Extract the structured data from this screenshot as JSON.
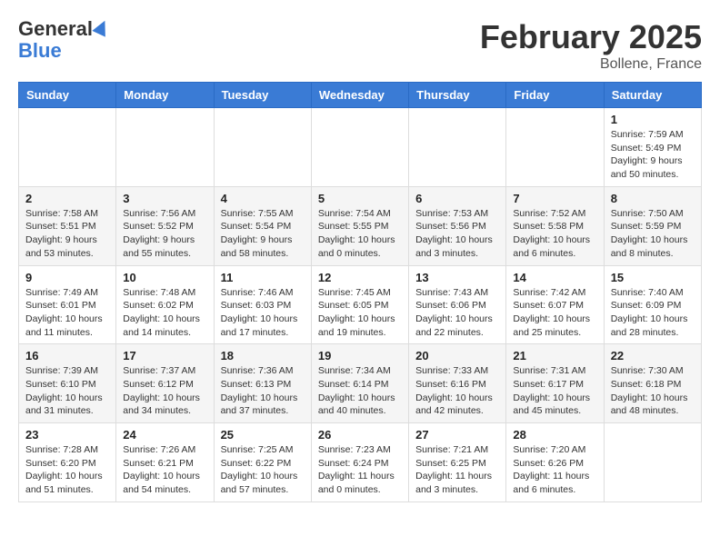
{
  "logo": {
    "general": "General",
    "blue": "Blue"
  },
  "header": {
    "month": "February 2025",
    "location": "Bollene, France"
  },
  "weekdays": [
    "Sunday",
    "Monday",
    "Tuesday",
    "Wednesday",
    "Thursday",
    "Friday",
    "Saturday"
  ],
  "weeks": [
    [
      {
        "day": "",
        "info": ""
      },
      {
        "day": "",
        "info": ""
      },
      {
        "day": "",
        "info": ""
      },
      {
        "day": "",
        "info": ""
      },
      {
        "day": "",
        "info": ""
      },
      {
        "day": "",
        "info": ""
      },
      {
        "day": "1",
        "info": "Sunrise: 7:59 AM\nSunset: 5:49 PM\nDaylight: 9 hours and 50 minutes."
      }
    ],
    [
      {
        "day": "2",
        "info": "Sunrise: 7:58 AM\nSunset: 5:51 PM\nDaylight: 9 hours and 53 minutes."
      },
      {
        "day": "3",
        "info": "Sunrise: 7:56 AM\nSunset: 5:52 PM\nDaylight: 9 hours and 55 minutes."
      },
      {
        "day": "4",
        "info": "Sunrise: 7:55 AM\nSunset: 5:54 PM\nDaylight: 9 hours and 58 minutes."
      },
      {
        "day": "5",
        "info": "Sunrise: 7:54 AM\nSunset: 5:55 PM\nDaylight: 10 hours and 0 minutes."
      },
      {
        "day": "6",
        "info": "Sunrise: 7:53 AM\nSunset: 5:56 PM\nDaylight: 10 hours and 3 minutes."
      },
      {
        "day": "7",
        "info": "Sunrise: 7:52 AM\nSunset: 5:58 PM\nDaylight: 10 hours and 6 minutes."
      },
      {
        "day": "8",
        "info": "Sunrise: 7:50 AM\nSunset: 5:59 PM\nDaylight: 10 hours and 8 minutes."
      }
    ],
    [
      {
        "day": "9",
        "info": "Sunrise: 7:49 AM\nSunset: 6:01 PM\nDaylight: 10 hours and 11 minutes."
      },
      {
        "day": "10",
        "info": "Sunrise: 7:48 AM\nSunset: 6:02 PM\nDaylight: 10 hours and 14 minutes."
      },
      {
        "day": "11",
        "info": "Sunrise: 7:46 AM\nSunset: 6:03 PM\nDaylight: 10 hours and 17 minutes."
      },
      {
        "day": "12",
        "info": "Sunrise: 7:45 AM\nSunset: 6:05 PM\nDaylight: 10 hours and 19 minutes."
      },
      {
        "day": "13",
        "info": "Sunrise: 7:43 AM\nSunset: 6:06 PM\nDaylight: 10 hours and 22 minutes."
      },
      {
        "day": "14",
        "info": "Sunrise: 7:42 AM\nSunset: 6:07 PM\nDaylight: 10 hours and 25 minutes."
      },
      {
        "day": "15",
        "info": "Sunrise: 7:40 AM\nSunset: 6:09 PM\nDaylight: 10 hours and 28 minutes."
      }
    ],
    [
      {
        "day": "16",
        "info": "Sunrise: 7:39 AM\nSunset: 6:10 PM\nDaylight: 10 hours and 31 minutes."
      },
      {
        "day": "17",
        "info": "Sunrise: 7:37 AM\nSunset: 6:12 PM\nDaylight: 10 hours and 34 minutes."
      },
      {
        "day": "18",
        "info": "Sunrise: 7:36 AM\nSunset: 6:13 PM\nDaylight: 10 hours and 37 minutes."
      },
      {
        "day": "19",
        "info": "Sunrise: 7:34 AM\nSunset: 6:14 PM\nDaylight: 10 hours and 40 minutes."
      },
      {
        "day": "20",
        "info": "Sunrise: 7:33 AM\nSunset: 6:16 PM\nDaylight: 10 hours and 42 minutes."
      },
      {
        "day": "21",
        "info": "Sunrise: 7:31 AM\nSunset: 6:17 PM\nDaylight: 10 hours and 45 minutes."
      },
      {
        "day": "22",
        "info": "Sunrise: 7:30 AM\nSunset: 6:18 PM\nDaylight: 10 hours and 48 minutes."
      }
    ],
    [
      {
        "day": "23",
        "info": "Sunrise: 7:28 AM\nSunset: 6:20 PM\nDaylight: 10 hours and 51 minutes."
      },
      {
        "day": "24",
        "info": "Sunrise: 7:26 AM\nSunset: 6:21 PM\nDaylight: 10 hours and 54 minutes."
      },
      {
        "day": "25",
        "info": "Sunrise: 7:25 AM\nSunset: 6:22 PM\nDaylight: 10 hours and 57 minutes."
      },
      {
        "day": "26",
        "info": "Sunrise: 7:23 AM\nSunset: 6:24 PM\nDaylight: 11 hours and 0 minutes."
      },
      {
        "day": "27",
        "info": "Sunrise: 7:21 AM\nSunset: 6:25 PM\nDaylight: 11 hours and 3 minutes."
      },
      {
        "day": "28",
        "info": "Sunrise: 7:20 AM\nSunset: 6:26 PM\nDaylight: 11 hours and 6 minutes."
      },
      {
        "day": "",
        "info": ""
      }
    ]
  ]
}
